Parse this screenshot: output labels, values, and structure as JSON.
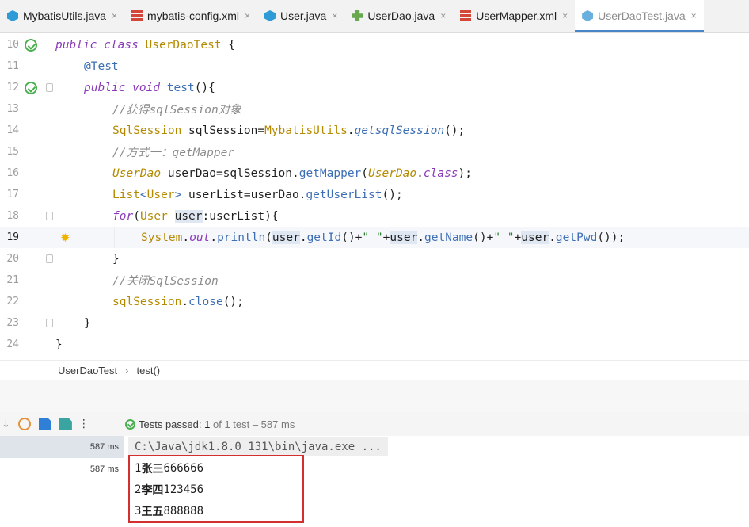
{
  "tabs": [
    {
      "label": "MybatisUtils.java",
      "icon": "java-class-icon"
    },
    {
      "label": "mybatis-config.xml",
      "icon": "xml-file-icon"
    },
    {
      "label": "User.java",
      "icon": "java-class-icon"
    },
    {
      "label": "UserDao.java",
      "icon": "interface-icon"
    },
    {
      "label": "UserMapper.xml",
      "icon": "xml-file-icon"
    },
    {
      "label": "UserDaoTest.java",
      "icon": "test-class-icon",
      "active": true
    }
  ],
  "tab_close_glyph": "×",
  "editor": {
    "line_numbers": [
      "10",
      "11",
      "12",
      "13",
      "14",
      "15",
      "16",
      "17",
      "18",
      "19",
      "20",
      "21",
      "22",
      "23",
      "24"
    ],
    "current_line": "19",
    "tokens": {
      "l10": [
        "public class ",
        "UserDaoTest",
        " {"
      ],
      "l11": [
        "@Test"
      ],
      "l12": [
        "public void ",
        "test",
        "(){"
      ],
      "l13": [
        "//获得sqlSession对象"
      ],
      "l14": [
        "SqlSession",
        " sqlSession=",
        "MybatisUtils",
        ".",
        "getsqlSession",
        "();"
      ],
      "l15": [
        "//方式一：getMapper"
      ],
      "l16": [
        "UserDao",
        " userDao=sqlSession.",
        "getMapper",
        "(",
        "UserDao",
        ".",
        "class",
        ");"
      ],
      "l17": [
        "List",
        "<",
        "User",
        "> ",
        "userList=userDao.",
        "getUserList",
        "();"
      ],
      "l18": [
        "for",
        "(",
        "User",
        " ",
        "user",
        ":userList){"
      ],
      "l19": [
        "System",
        ".",
        "out",
        ".",
        "println",
        "(",
        "user",
        ".",
        "getId",
        "()+",
        "\" \"",
        "+",
        "user",
        ".",
        "getName",
        "()+",
        "\" \"",
        "+",
        "user",
        ".",
        "getPwd",
        "());"
      ],
      "l20": [
        "}"
      ],
      "l21": [
        "//关闭SqlSession"
      ],
      "l22": [
        "sqlSession",
        ".",
        "close",
        "();"
      ],
      "l23": [
        "}"
      ],
      "l24": [
        "}"
      ]
    }
  },
  "breadcrumb": {
    "items": [
      "UserDaoTest",
      "test()"
    ],
    "separator": "›"
  },
  "run": {
    "status_label": "Tests passed:",
    "passed": "1",
    "of_text": "of 1 test – 587 ms",
    "tree_rows": [
      "587 ms",
      "587 ms"
    ],
    "command": "C:\\Java\\jdk1.8.0_131\\bin\\java.exe ...",
    "output": [
      {
        "id": "1",
        "name": "张三",
        "pwd": "666666"
      },
      {
        "id": "2",
        "name": "李四",
        "pwd": "123456"
      },
      {
        "id": "3",
        "name": "王五",
        "pwd": "888888"
      }
    ],
    "more_glyph": "⋮"
  },
  "colors": {
    "accent": "#4a86c7",
    "pass": "#4caf50",
    "highlight_box": "#d32f2f"
  }
}
